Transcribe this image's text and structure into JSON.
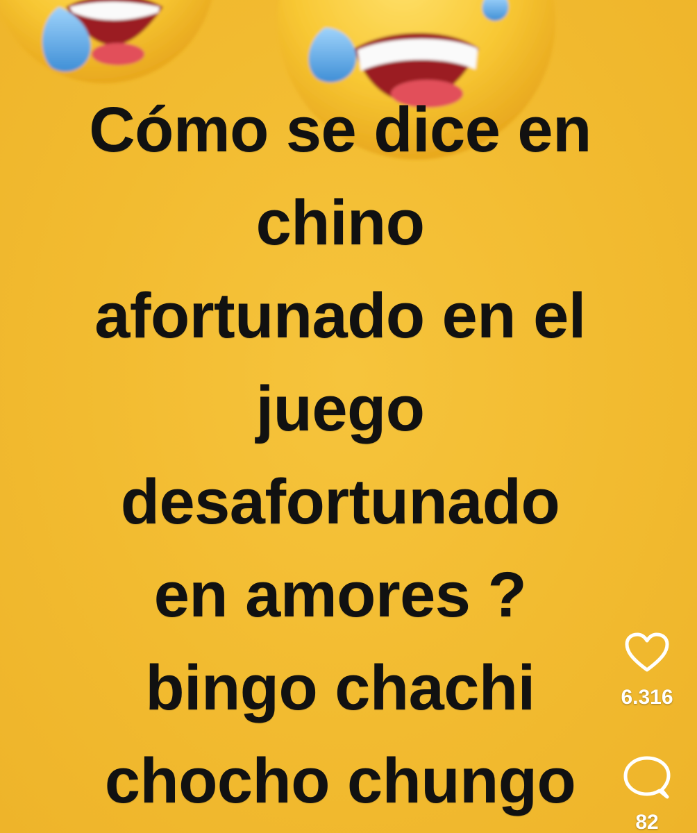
{
  "meme": {
    "lines": [
      "Cómo se dice en",
      "chino",
      "afortunado en el",
      "juego",
      "desafortunado",
      "en amores ?",
      "bingo chachi",
      "chocho chungo"
    ]
  },
  "actions": {
    "like": {
      "icon": "heart-outline-icon",
      "count": "6.316"
    },
    "comment": {
      "icon": "speech-bubble-icon",
      "count": "82"
    }
  },
  "colors": {
    "background": "#f2bc32",
    "text": "#111111",
    "overlay_text": "#ffffff",
    "emoji_face": "#f7c52d",
    "tear": "#5aa9e6",
    "mouth": "#9b1f24"
  }
}
